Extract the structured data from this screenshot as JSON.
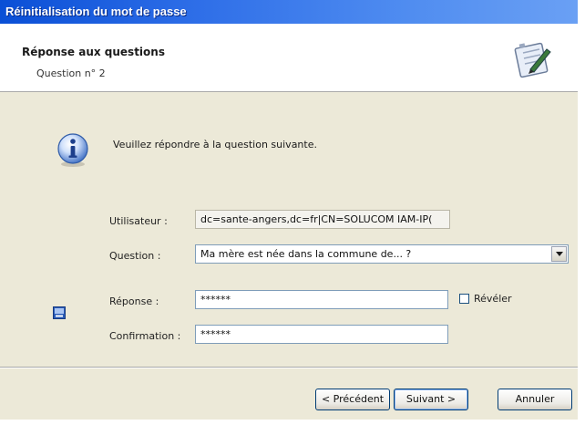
{
  "window": {
    "title": "Réinitialisation du mot de passe"
  },
  "header": {
    "title": "Réponse aux questions",
    "subtitle": "Question n° 2",
    "icon": "wizard-notepad-icon"
  },
  "content": {
    "info_icon": "info-icon",
    "instruction": "Veuillez répondre à la question suivante.",
    "user_label": "Utilisateur :",
    "user_value": "dc=sante-angers,dc=fr|CN=SOLUCOM IAM-IP(",
    "question_label": "Question :",
    "question_value": "Ma mère est née dans la commune de... ?",
    "answer_label": "Réponse :",
    "answer_value": "******",
    "reveal_label": "Révéler",
    "reveal_checked": false,
    "confirm_label": "Confirmation :",
    "confirm_value": "******"
  },
  "buttons": {
    "previous": "< Précédent",
    "next": "Suivant >",
    "cancel": "Annuler"
  },
  "colors": {
    "titlebar": "#2f6fe8",
    "dialog_bg": "#ece9d8",
    "button_border": "#003c74"
  }
}
